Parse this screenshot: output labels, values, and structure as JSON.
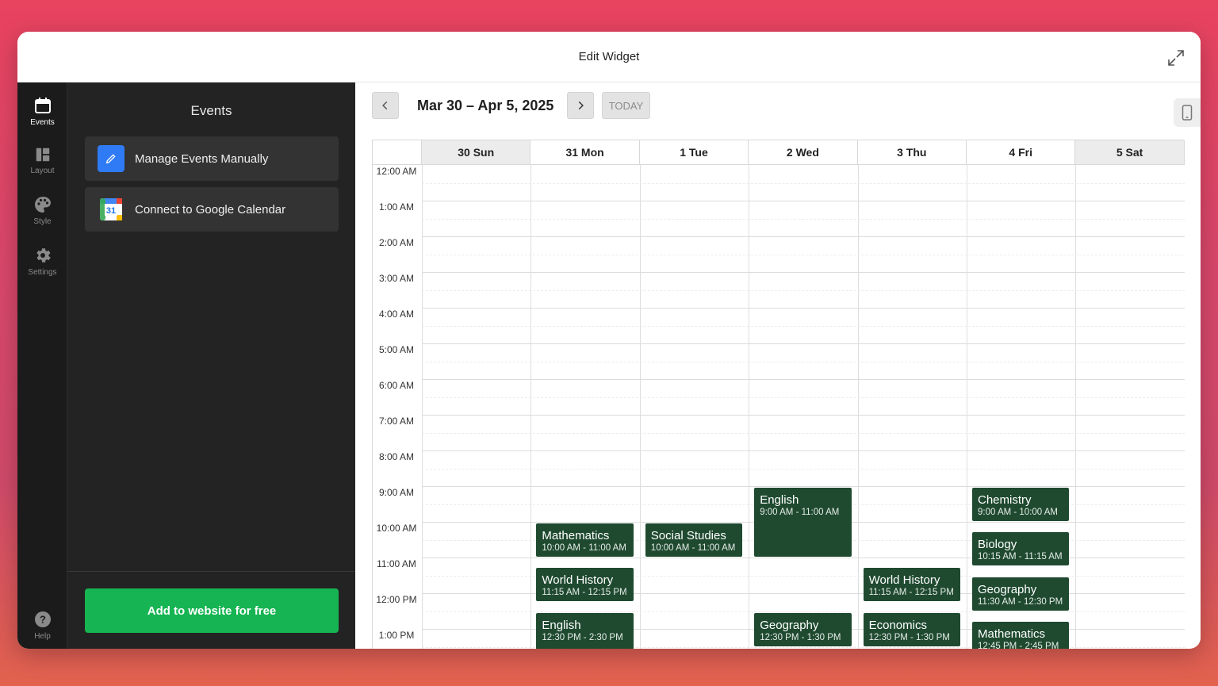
{
  "window": {
    "title": "Edit Widget"
  },
  "rail": {
    "items": [
      {
        "label": "Events",
        "icon": "calendar-icon",
        "active": true
      },
      {
        "label": "Layout",
        "icon": "layout-icon"
      },
      {
        "label": "Style",
        "icon": "palette-icon"
      },
      {
        "label": "Settings",
        "icon": "gear-icon"
      }
    ],
    "help": {
      "label": "Help",
      "icon": "help-icon"
    }
  },
  "panel": {
    "title": "Events",
    "manual_label": "Manage Events Manually",
    "google_label": "Connect to Google Calendar",
    "google_icon_text": "31",
    "cta_label": "Add to website for free"
  },
  "calendar": {
    "range": "Mar 30 – Apr 5, 2025",
    "today_label": "TODAY",
    "days": [
      "30 Sun",
      "31 Mon",
      "1 Tue",
      "2 Wed",
      "3 Thu",
      "4 Fri",
      "5 Sat"
    ],
    "times": [
      "12:00 AM",
      "1:00 AM",
      "2:00 AM",
      "3:00 AM",
      "4:00 AM",
      "5:00 AM",
      "6:00 AM",
      "7:00 AM",
      "8:00 AM",
      "9:00 AM",
      "10:00 AM",
      "11:00 AM",
      "12:00 PM",
      "1:00 PM"
    ],
    "events": [
      {
        "day": 1,
        "title": "Mathematics",
        "time": "10:00 AM - 11:00 AM",
        "start": 10.0,
        "end": 11.0
      },
      {
        "day": 1,
        "title": "World History",
        "time": "11:15 AM - 12:15 PM",
        "start": 11.25,
        "end": 12.25
      },
      {
        "day": 1,
        "title": "English",
        "time": "12:30 PM - 2:30 PM",
        "start": 12.5,
        "end": 14.5
      },
      {
        "day": 2,
        "title": "Social Studies",
        "time": "10:00 AM - 11:00 AM",
        "start": 10.0,
        "end": 11.0
      },
      {
        "day": 3,
        "title": "English",
        "time": "9:00 AM - 11:00 AM",
        "start": 9.0,
        "end": 11.0
      },
      {
        "day": 3,
        "title": "Geography",
        "time": "12:30 PM - 1:30 PM",
        "start": 12.5,
        "end": 13.5
      },
      {
        "day": 4,
        "title": "World History",
        "time": "11:15 AM - 12:15 PM",
        "start": 11.25,
        "end": 12.25
      },
      {
        "day": 4,
        "title": "Economics",
        "time": "12:30 PM - 1:30 PM",
        "start": 12.5,
        "end": 13.5
      },
      {
        "day": 5,
        "title": "Chemistry",
        "time": "9:00 AM - 10:00 AM",
        "start": 9.0,
        "end": 10.0
      },
      {
        "day": 5,
        "title": "Biology",
        "time": "10:15 AM - 11:15 AM",
        "start": 10.25,
        "end": 11.25
      },
      {
        "day": 5,
        "title": "Geography",
        "time": "11:30 AM - 12:30 PM",
        "start": 11.5,
        "end": 12.5
      },
      {
        "day": 5,
        "title": "Mathematics",
        "time": "12:45 PM - 2:45 PM",
        "start": 12.75,
        "end": 14.75
      }
    ]
  },
  "colors": {
    "accent_green": "#16b452",
    "event_bg": "#1f4a30",
    "manual_icon_bg": "#2f7bf5",
    "rail_bg": "#1b1b1b",
    "panel_bg": "#232323"
  }
}
